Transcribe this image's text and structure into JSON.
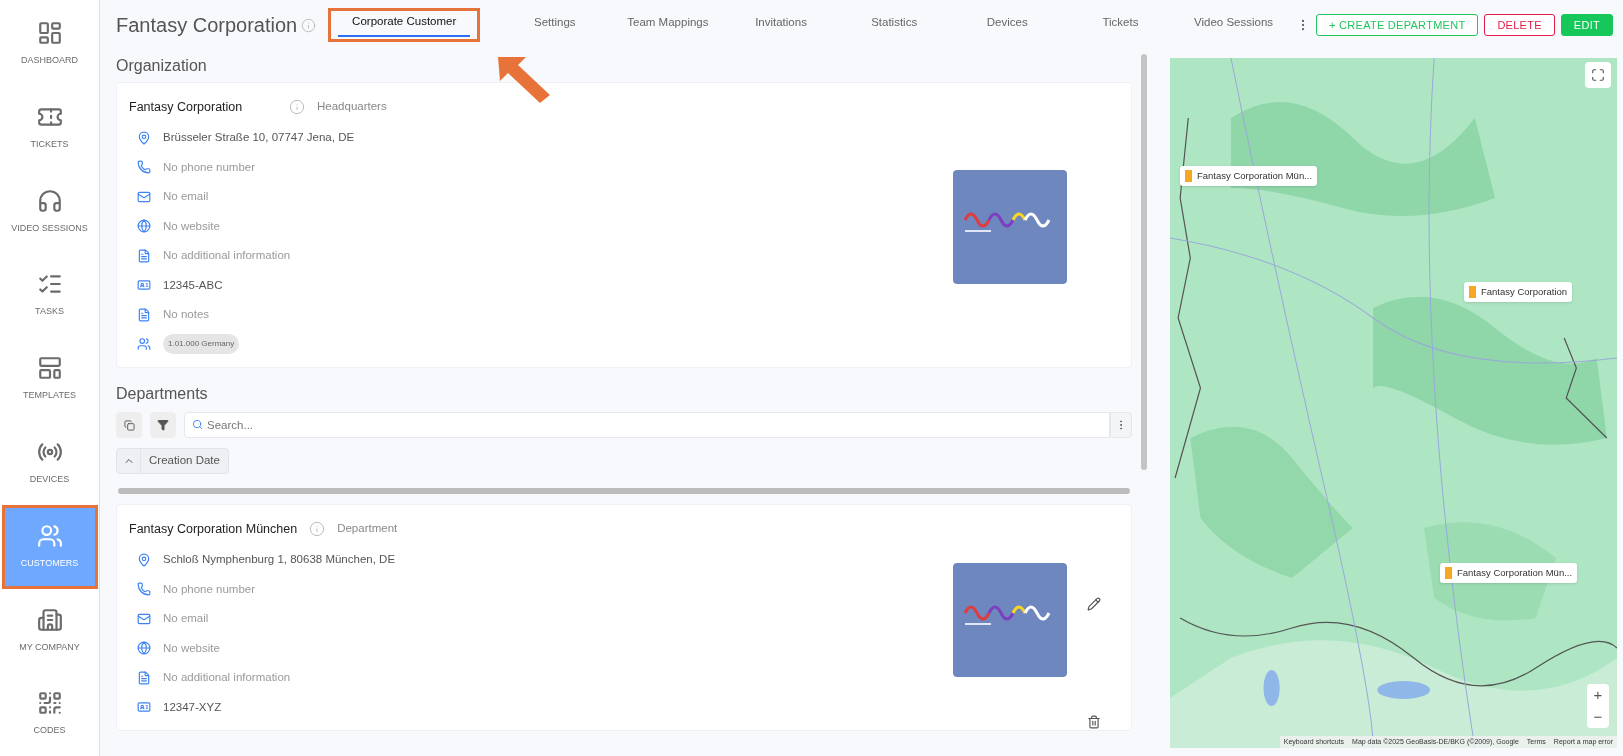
{
  "sidebar": {
    "items": [
      {
        "label": "DASHBOARD",
        "selected": false
      },
      {
        "label": "TICKETS",
        "selected": false
      },
      {
        "label": "VIDEO SESSIONS",
        "selected": false
      },
      {
        "label": "TASKS",
        "selected": false
      },
      {
        "label": "TEMPLATES",
        "selected": false
      },
      {
        "label": "DEVICES",
        "selected": false
      },
      {
        "label": "CUSTOMERS",
        "selected": true
      },
      {
        "label": "MY COMPANY",
        "selected": false
      },
      {
        "label": "CODES",
        "selected": false
      }
    ]
  },
  "header": {
    "title": "Fantasy Corporation",
    "tabs": [
      {
        "label": "Corporate Customer",
        "selected": true
      },
      {
        "label": "Settings",
        "selected": false
      },
      {
        "label": "Team Mappings",
        "selected": false
      },
      {
        "label": "Invitations",
        "selected": false
      },
      {
        "label": "Statistics",
        "selected": false
      },
      {
        "label": "Devices",
        "selected": false
      },
      {
        "label": "Tickets",
        "selected": false
      },
      {
        "label": "Video Sessions",
        "selected": false
      }
    ],
    "buttons": [
      {
        "label": "+ CREATE DEPARTMENT",
        "kind": "outline-green"
      },
      {
        "label": "DELETE",
        "kind": "outline-red"
      },
      {
        "label": "EDIT",
        "kind": "solid-green"
      }
    ]
  },
  "organization": {
    "heading": "Organization",
    "card": {
      "name": "Fantasy Corporation",
      "type": "Headquarters",
      "editable": false,
      "rows": [
        {
          "kind": "address",
          "text": "Brüsseler Straße 10, 07747 Jena, DE",
          "empty": false
        },
        {
          "kind": "phone",
          "text": "No phone number",
          "empty": true
        },
        {
          "kind": "email",
          "text": "No email",
          "empty": true
        },
        {
          "kind": "website",
          "text": "No website",
          "empty": true
        },
        {
          "kind": "info",
          "text": "No additional information",
          "empty": true
        },
        {
          "kind": "id",
          "text": "12345-ABC",
          "empty": false
        },
        {
          "kind": "notes",
          "text": "No notes",
          "empty": true
        },
        {
          "kind": "tag",
          "text": "1.01.000 Germany",
          "empty": false
        }
      ]
    }
  },
  "departments": {
    "heading": "Departments",
    "search": {
      "placeholder": "Search..."
    },
    "sort": {
      "label": "Creation Date"
    },
    "cards": [
      {
        "name": "Fantasy Corporation München",
        "type": "Department",
        "editable": true,
        "rows": [
          {
            "kind": "address",
            "text": "Schloß Nymphenburg 1, 80638 München, DE",
            "empty": false
          },
          {
            "kind": "phone",
            "text": "No phone number",
            "empty": true
          },
          {
            "kind": "email",
            "text": "No email",
            "empty": true
          },
          {
            "kind": "website",
            "text": "No website",
            "empty": true
          },
          {
            "kind": "info",
            "text": "No additional information",
            "empty": true
          },
          {
            "kind": "id",
            "text": "12347-XYZ",
            "empty": false
          }
        ]
      }
    ]
  },
  "map": {
    "markers": [
      {
        "label": "Fantasy Corporation Mün..."
      },
      {
        "label": "Fantasy Corporation"
      },
      {
        "label": "Fantasy Corporation Mün..."
      }
    ],
    "zoom_in": "+",
    "zoom_out": "−",
    "attribution": [
      "Keyboard shortcuts",
      "Map data ©2025 GeoBasis-DE/BKG (©2009), Google",
      "Terms",
      "Report a map error"
    ]
  }
}
